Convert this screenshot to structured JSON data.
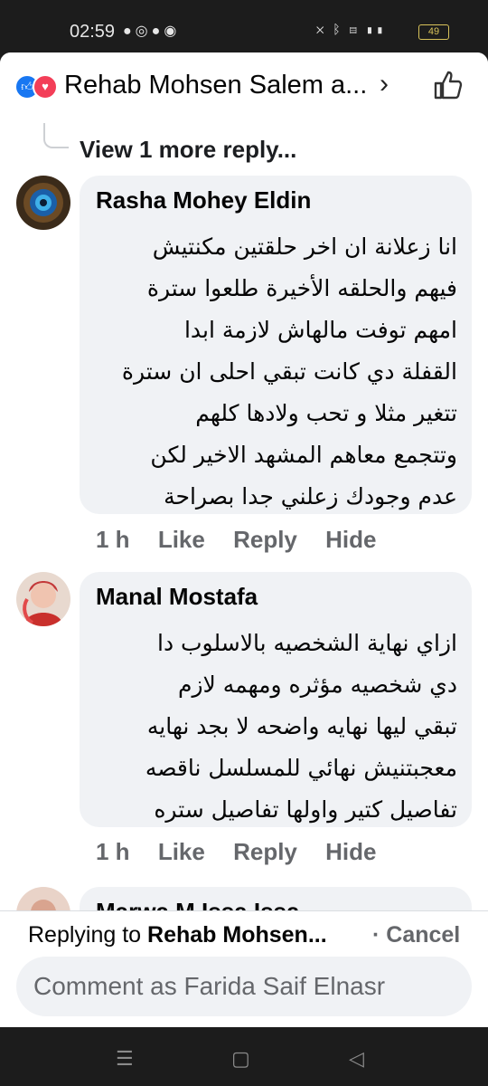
{
  "status_bar": {
    "time": "02:59",
    "notifications": [
      "chat-icon",
      "whatsapp-icon",
      "facebook-icon",
      "messenger-icon"
    ],
    "battery": "49"
  },
  "header": {
    "title": "Rehab Mohsen Salem a...",
    "reactions": [
      "like",
      "love"
    ]
  },
  "view_more": "View 1 more reply...",
  "comments": [
    {
      "name": "Rasha Mohey Eldin",
      "lines": [
        "انا زعلانة ان اخر حلقتين مكنتيش",
        "فيهم والحلقه الأخيرة طلعوا سترة",
        "امهم توفت مالهاش لازمة ابدا",
        "القفلة دي كانت تبقي احلى ان سترة",
        "تتغير مثلا و تحب ولادها كلهم",
        "وتتجمع معاهم المشهد الاخير لكن",
        "عدم وجودك زعلني جدا بصراحة"
      ],
      "time": "1 h",
      "like": "Like",
      "reply": "Reply",
      "hide": "Hide"
    },
    {
      "name": "Manal Mostafa",
      "lines": [
        "ازاي نهاية الشخصيه بالاسلوب دا",
        "دي شخصيه مؤثره ومهمه لازم",
        "تبقي ليها نهايه واضحه لا بجد نهايه",
        "معجبتنيش نهائي للمسلسل ناقصه",
        "تفاصيل كتير واولها تفاصيل ستره"
      ],
      "time": "1 h",
      "like": "Like",
      "reply": "Reply",
      "hide": "Hide"
    },
    {
      "name": "Marwa M Issa Issa"
    }
  ],
  "reply_bar": {
    "prefix": "Replying to ",
    "target": "Rehab Mohsen...",
    "cancel": "· Cancel",
    "placeholder": "Comment as Farida Saif Elnasr"
  },
  "colors": {
    "bubble": "#f0f2f5",
    "secondary_text": "#65676b",
    "like_blue": "#1877f2",
    "love_red": "#f33e58"
  }
}
